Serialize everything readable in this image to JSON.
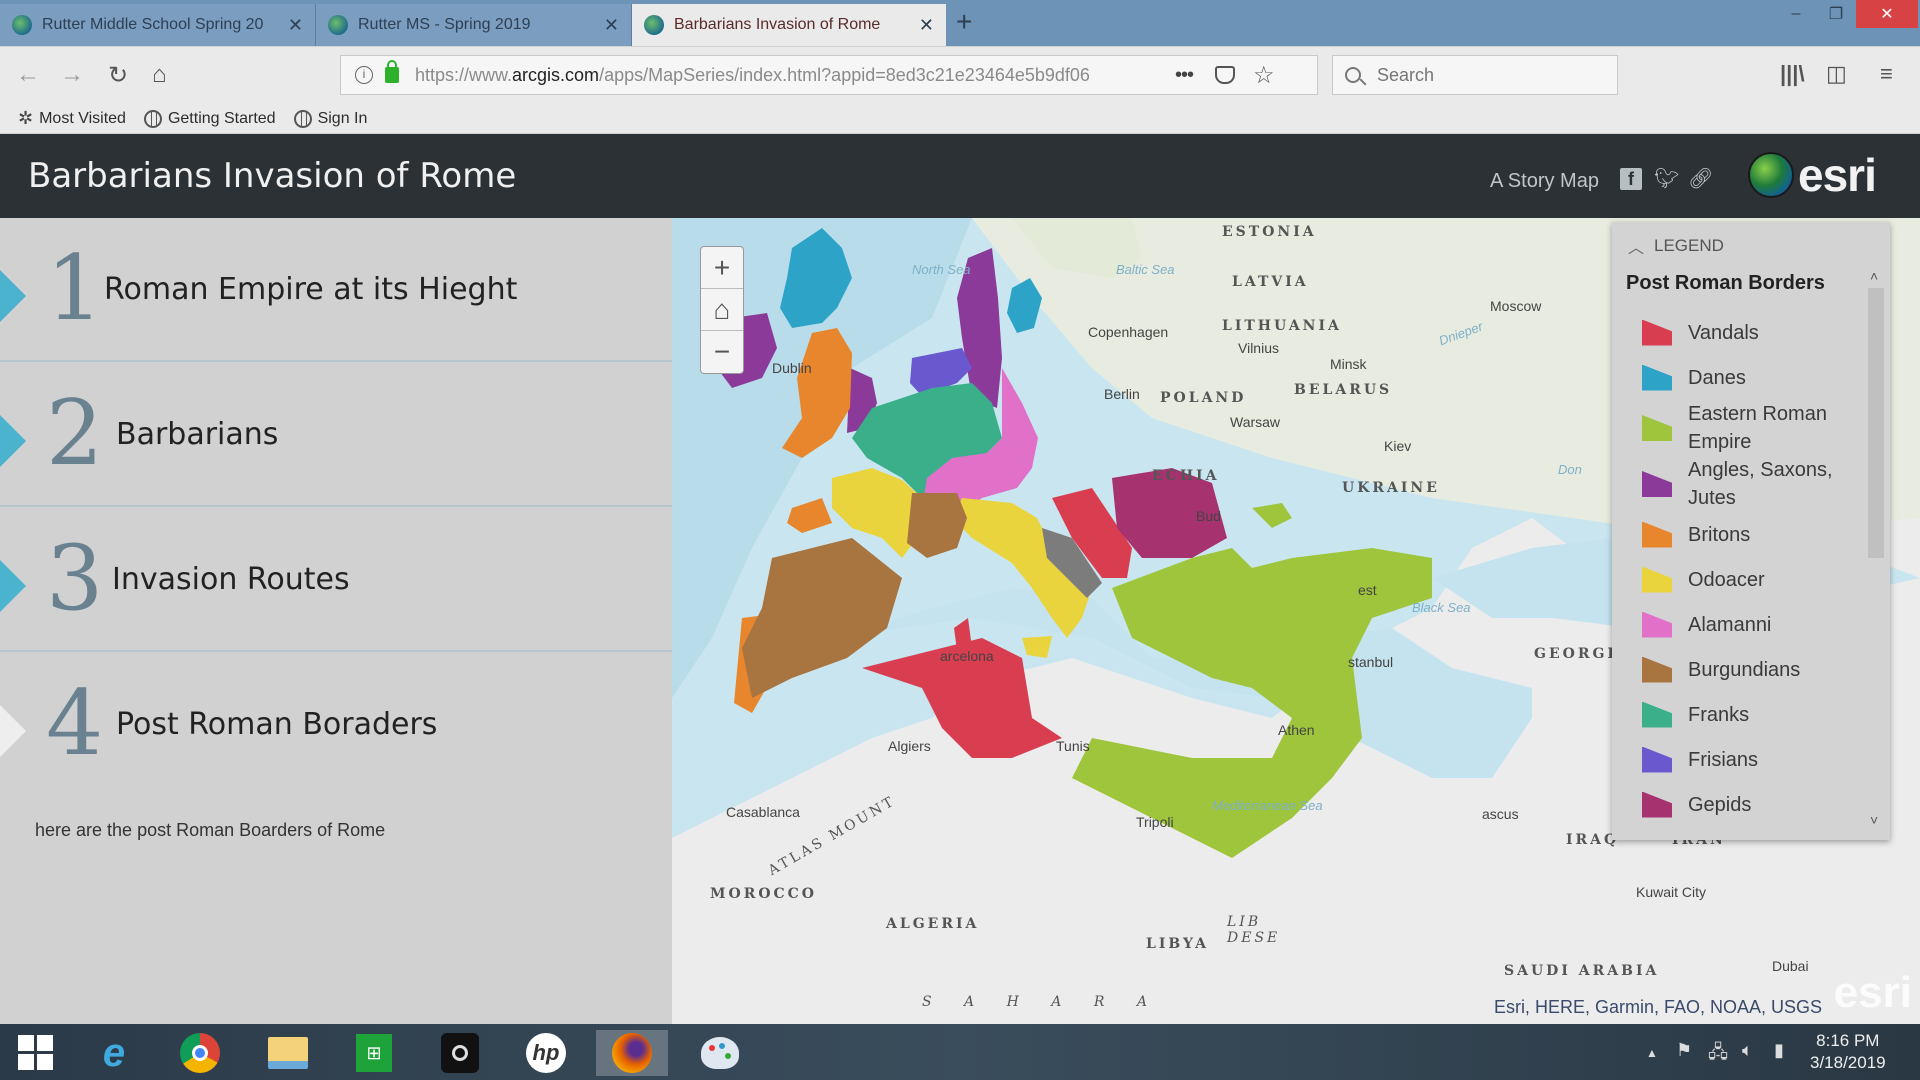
{
  "browser": {
    "tabs": [
      {
        "label": "Rutter Middle School Spring 20",
        "active": false
      },
      {
        "label": "Rutter MS - Spring 2019",
        "active": false
      },
      {
        "label": "Barbarians Invasion of Rome",
        "active": true
      }
    ],
    "url_prefix": "https://www.",
    "url_domain": "arcgis.com",
    "url_rest": "/apps/MapSeries/index.html?appid=8ed3c21e23464e5b9df06",
    "search_placeholder": "Search",
    "bookmarks": [
      "Most Visited",
      "Getting Started",
      "Sign In"
    ]
  },
  "app": {
    "title": "Barbarians Invasion of Rome",
    "subtitle": "A Story Map",
    "brand": "esri"
  },
  "entries": [
    {
      "number": "1",
      "title": "Roman Empire at its Hieght"
    },
    {
      "number": "2",
      "title": "Barbarians"
    },
    {
      "number": "3",
      "title": "Invasion Routes"
    },
    {
      "number": "4",
      "title": "Post Roman Boraders"
    }
  ],
  "current_entry_description": "here are the post Roman Boarders of Rome",
  "map": {
    "labels": {
      "estonia": "ESTONIA",
      "latvia": "LATVIA",
      "lithuania": "LITHUANIA",
      "belarus": "BELARUS",
      "poland": "POLAND",
      "ukraine": "UKRAINE",
      "czechia": "ECHIA",
      "georgia": "GEORGIA",
      "morocco": "MOROCCO",
      "algeria": "ALGERIA",
      "libya": "LIBYA",
      "iraq": "IRAQ",
      "saudi": "SAUDI ARABIA",
      "iran": "IRAN",
      "sahara": "S  A  H  A  R  A",
      "atlas": "ATLAS MOUNT",
      "libyan_desert": "LIB DESE",
      "north_sea": "North Sea",
      "baltic_sea": "Baltic Sea",
      "black_sea": "Black Sea",
      "med_sea": "Mediterranean Sea",
      "moscow": "Moscow",
      "minsk": "Minsk",
      "vilnius": "Vilnius",
      "warsaw": "Warsaw",
      "berlin": "Berlin",
      "copenhagen": "Copenhagen",
      "kiev": "Kiev",
      "dublin": "Dublin",
      "barcelona": "arcelona",
      "algiers": "Algiers",
      "tunis": "Tunis",
      "tripoli": "Tripoli",
      "casablanca": "Casablanca",
      "istanbul": "stanbul",
      "athens": "Athen",
      "bucharest": "est",
      "buda": "Bud",
      "damascus": "ascus",
      "kuwait": "Kuwait City",
      "dubai": "Dubai",
      "dnieper": "Dnieper",
      "don": "Don"
    },
    "zoom_in": "+",
    "zoom_out": "−",
    "attribution": "Esri, HERE, Garmin, FAO, NOAA, USGS",
    "watermark": "esri"
  },
  "legend": {
    "header": "LEGEND",
    "title": "Post Roman Borders",
    "items": [
      {
        "label": "Vandals",
        "color": "#d93e50"
      },
      {
        "label": "Danes",
        "color": "#2ea3c8"
      },
      {
        "label": "Eastern Roman Empire",
        "color": "#9ec53c"
      },
      {
        "label": "Angles, Saxons, Jutes",
        "color": "#8c3a9a"
      },
      {
        "label": "Britons",
        "color": "#e8862e"
      },
      {
        "label": "Odoacer",
        "color": "#ead43e"
      },
      {
        "label": "Alamanni",
        "color": "#e070c8"
      },
      {
        "label": "Burgundians",
        "color": "#a87440"
      },
      {
        "label": "Franks",
        "color": "#3aaf8a"
      },
      {
        "label": "Frisians",
        "color": "#6a58cf"
      },
      {
        "label": "Gepids",
        "color": "#a63270"
      }
    ]
  },
  "taskbar": {
    "time": "8:16 PM",
    "date": "3/18/2019"
  }
}
